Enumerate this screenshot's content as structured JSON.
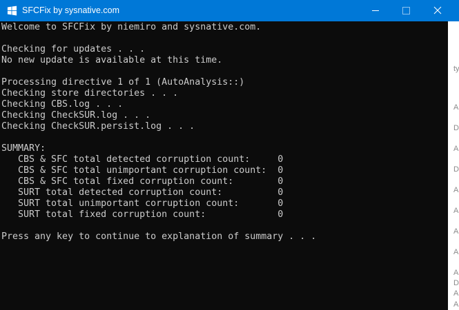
{
  "window": {
    "title": "SFCFix by sysnative.com",
    "titlebar_color": "#0078d7",
    "console_background": "#0c0c0c",
    "console_text_color": "#cccccc",
    "icons": {
      "app": "windows-logo-icon",
      "minimize": "minimize-icon",
      "maximize": "maximize-icon",
      "close": "close-icon"
    }
  },
  "console": {
    "lines": [
      "Welcome to SFCFix by niemiro and sysnative.com.",
      "",
      "Checking for updates . . .",
      "No new update is available at this time.",
      "",
      "Processing directive 1 of 1 (AutoAnalysis::)",
      "Checking store directories . . .",
      "Checking CBS.log . . .",
      "Checking CheckSUR.log . . .",
      "Checking CheckSUR.persist.log . . .",
      "",
      "SUMMARY:",
      "   CBS & SFC total detected corruption count:     0",
      "   CBS & SFC total unimportant corruption count:  0",
      "   CBS & SFC total fixed corruption count:        0",
      "   SURT total detected corruption count:          0",
      "   SURT total unimportant corruption count:       0",
      "   SURT total fixed corruption count:             0",
      "",
      "Press any key to continue to explanation of summary . . ."
    ]
  },
  "background_peek": {
    "fragments": [
      "ty",
      "Ap",
      "De",
      "Ap",
      "De",
      "Ap",
      "Ap",
      "Ap",
      "Ap",
      "Ap",
      "De",
      "Ap",
      "Ap"
    ]
  }
}
